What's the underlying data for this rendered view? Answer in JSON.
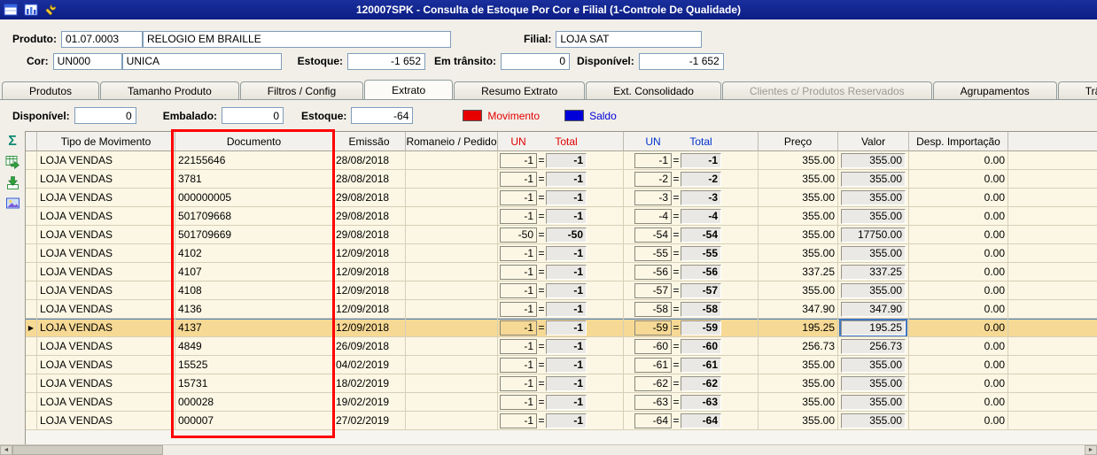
{
  "title_bar": {
    "title": "120007SPK - Consulta de Estoque Por Cor e Filial (1-Controle De Qualidade)"
  },
  "header": {
    "produto_label": "Produto:",
    "produto_code": "01.07.0003",
    "produto_name": "RELOGIO EM BRAILLE",
    "filial_label": "Filial:",
    "filial_value": "LOJA SAT",
    "cor_label": "Cor:",
    "cor_code": "UN000",
    "cor_name": "UNICA",
    "estoque_label": "Estoque:",
    "estoque_value": "-1 652",
    "em_transito_label": "Em trânsito:",
    "em_transito_value": "0",
    "disponivel_label": "Disponível:",
    "disponivel_value": "-1 652"
  },
  "tabs": [
    {
      "label": "Produtos",
      "active": false,
      "disabled": false
    },
    {
      "label": "Tamanho Produto",
      "active": false,
      "disabled": false
    },
    {
      "label": "Filtros / Config",
      "active": false,
      "disabled": false
    },
    {
      "label": "Extrato",
      "active": true,
      "disabled": false
    },
    {
      "label": "Resumo Extrato",
      "active": false,
      "disabled": false
    },
    {
      "label": "Ext. Consolidado",
      "active": false,
      "disabled": false
    },
    {
      "label": "Clientes c/ Produtos Reservados",
      "active": false,
      "disabled": true
    },
    {
      "label": "Agrupamentos",
      "active": false,
      "disabled": false
    },
    {
      "label": "Trâns",
      "active": false,
      "disabled": false
    }
  ],
  "summary": {
    "disponivel_label": "Disponível:",
    "disponivel_value": "0",
    "embalado_label": "Embalado:",
    "embalado_value": "0",
    "estoque_label": "Estoque:",
    "estoque_value": "-64",
    "legend": {
      "movimento_label": "Movimento",
      "movimento_color": "#e60000",
      "saldo_label": "Saldo",
      "saldo_color": "#0000d9"
    }
  },
  "annotation": {
    "color": "#ff0000"
  },
  "grid": {
    "equals_sign": "=",
    "selected_marker": "▶",
    "headers": {
      "tipo": "Tipo de Movimento",
      "documento": "Documento",
      "emissao": "Emissão",
      "romaneio": "Romaneio / Pedido",
      "mov_un": "UN",
      "mov_total": "Total",
      "saldo_un": "UN",
      "saldo_total": "Total",
      "preco": "Preço",
      "valor": "Valor",
      "desp": "Desp. Importação"
    },
    "rows": [
      {
        "tipo": "LOJA VENDAS",
        "documento": "22155646",
        "emissao": "28/08/2018",
        "romaneio": "",
        "mov_un": "-1",
        "mov_total": "-1",
        "saldo_un": "-1",
        "saldo_total": "-1",
        "preco": "355.00",
        "valor": "355.00",
        "desp": "0.00",
        "selected": false
      },
      {
        "tipo": "LOJA VENDAS",
        "documento": "3781",
        "emissao": "28/08/2018",
        "romaneio": "",
        "mov_un": "-1",
        "mov_total": "-1",
        "saldo_un": "-2",
        "saldo_total": "-2",
        "preco": "355.00",
        "valor": "355.00",
        "desp": "0.00",
        "selected": false
      },
      {
        "tipo": "LOJA VENDAS",
        "documento": "000000005",
        "emissao": "29/08/2018",
        "romaneio": "",
        "mov_un": "-1",
        "mov_total": "-1",
        "saldo_un": "-3",
        "saldo_total": "-3",
        "preco": "355.00",
        "valor": "355.00",
        "desp": "0.00",
        "selected": false
      },
      {
        "tipo": "LOJA VENDAS",
        "documento": "501709668",
        "emissao": "29/08/2018",
        "romaneio": "",
        "mov_un": "-1",
        "mov_total": "-1",
        "saldo_un": "-4",
        "saldo_total": "-4",
        "preco": "355.00",
        "valor": "355.00",
        "desp": "0.00",
        "selected": false
      },
      {
        "tipo": "LOJA VENDAS",
        "documento": "501709669",
        "emissao": "29/08/2018",
        "romaneio": "",
        "mov_un": "-50",
        "mov_total": "-50",
        "saldo_un": "-54",
        "saldo_total": "-54",
        "preco": "355.00",
        "valor": "17750.00",
        "desp": "0.00",
        "selected": false
      },
      {
        "tipo": "LOJA VENDAS",
        "documento": "4102",
        "emissao": "12/09/2018",
        "romaneio": "",
        "mov_un": "-1",
        "mov_total": "-1",
        "saldo_un": "-55",
        "saldo_total": "-55",
        "preco": "355.00",
        "valor": "355.00",
        "desp": "0.00",
        "selected": false
      },
      {
        "tipo": "LOJA VENDAS",
        "documento": "4107",
        "emissao": "12/09/2018",
        "romaneio": "",
        "mov_un": "-1",
        "mov_total": "-1",
        "saldo_un": "-56",
        "saldo_total": "-56",
        "preco": "337.25",
        "valor": "337.25",
        "desp": "0.00",
        "selected": false
      },
      {
        "tipo": "LOJA VENDAS",
        "documento": "4108",
        "emissao": "12/09/2018",
        "romaneio": "",
        "mov_un": "-1",
        "mov_total": "-1",
        "saldo_un": "-57",
        "saldo_total": "-57",
        "preco": "355.00",
        "valor": "355.00",
        "desp": "0.00",
        "selected": false
      },
      {
        "tipo": "LOJA VENDAS",
        "documento": "4136",
        "emissao": "12/09/2018",
        "romaneio": "",
        "mov_un": "-1",
        "mov_total": "-1",
        "saldo_un": "-58",
        "saldo_total": "-58",
        "preco": "347.90",
        "valor": "347.90",
        "desp": "0.00",
        "selected": false
      },
      {
        "tipo": "LOJA VENDAS",
        "documento": "4137",
        "emissao": "12/09/2018",
        "romaneio": "",
        "mov_un": "-1",
        "mov_total": "-1",
        "saldo_un": "-59",
        "saldo_total": "-59",
        "preco": "195.25",
        "valor": "195.25",
        "desp": "0.00",
        "selected": true
      },
      {
        "tipo": "LOJA VENDAS",
        "documento": "4849",
        "emissao": "26/09/2018",
        "romaneio": "",
        "mov_un": "-1",
        "mov_total": "-1",
        "saldo_un": "-60",
        "saldo_total": "-60",
        "preco": "256.73",
        "valor": "256.73",
        "desp": "0.00",
        "selected": false
      },
      {
        "tipo": "LOJA VENDAS",
        "documento": "15525",
        "emissao": "04/02/2019",
        "romaneio": "",
        "mov_un": "-1",
        "mov_total": "-1",
        "saldo_un": "-61",
        "saldo_total": "-61",
        "preco": "355.00",
        "valor": "355.00",
        "desp": "0.00",
        "selected": false
      },
      {
        "tipo": "LOJA VENDAS",
        "documento": "15731",
        "emissao": "18/02/2019",
        "romaneio": "",
        "mov_un": "-1",
        "mov_total": "-1",
        "saldo_un": "-62",
        "saldo_total": "-62",
        "preco": "355.00",
        "valor": "355.00",
        "desp": "0.00",
        "selected": false
      },
      {
        "tipo": "LOJA VENDAS",
        "documento": "000028",
        "emissao": "19/02/2019",
        "romaneio": "",
        "mov_un": "-1",
        "mov_total": "-1",
        "saldo_un": "-63",
        "saldo_total": "-63",
        "preco": "355.00",
        "valor": "355.00",
        "desp": "0.00",
        "selected": false
      },
      {
        "tipo": "LOJA VENDAS",
        "documento": "000007",
        "emissao": "27/02/2019",
        "romaneio": "",
        "mov_un": "-1",
        "mov_total": "-1",
        "saldo_un": "-64",
        "saldo_total": "-64",
        "preco": "355.00",
        "valor": "355.00",
        "desp": "0.00",
        "selected": false
      }
    ]
  }
}
